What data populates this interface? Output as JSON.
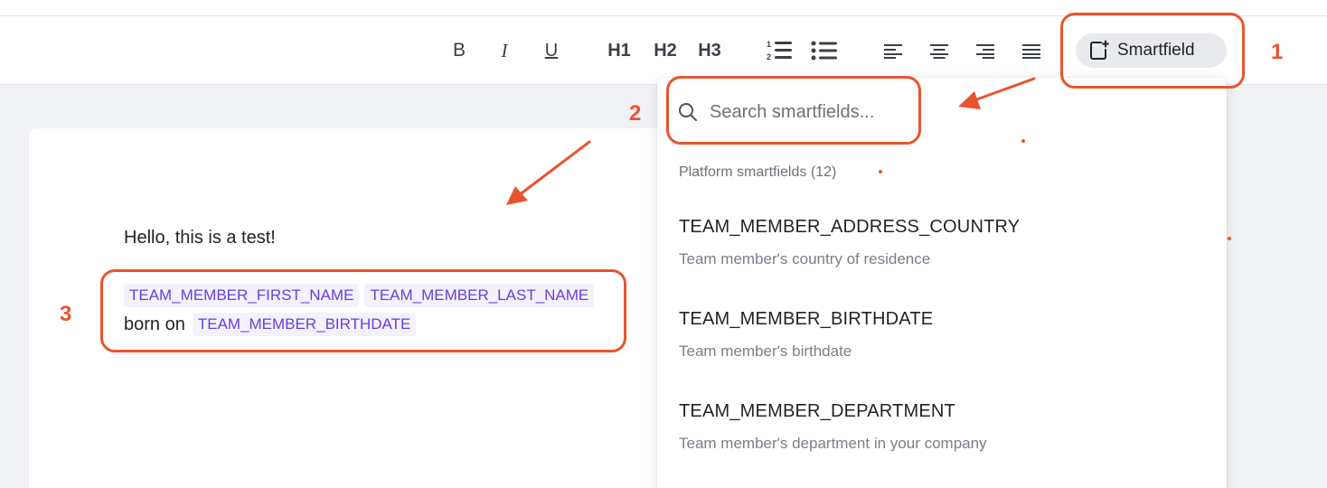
{
  "toolbar": {
    "bold": "B",
    "italic": "I",
    "underline": "U",
    "h1": "H1",
    "h2": "H2",
    "h3": "H3",
    "smartfield_label": "Smartfield"
  },
  "document": {
    "line1": "Hello, this is a test!",
    "chip_first_name": "TEAM_MEMBER_FIRST_NAME",
    "chip_last_name": "TEAM_MEMBER_LAST_NAME",
    "born_on": "born on",
    "chip_birthdate": "TEAM_MEMBER_BIRTHDATE"
  },
  "dropdown": {
    "search_placeholder": "Search smartfields...",
    "section_title": "Platform smartfields (12)",
    "items": [
      {
        "name": "TEAM_MEMBER_ADDRESS_COUNTRY",
        "desc": "Team member's country of residence"
      },
      {
        "name": "TEAM_MEMBER_BIRTHDATE",
        "desc": "Team member's birthdate"
      },
      {
        "name": "TEAM_MEMBER_DEPARTMENT",
        "desc": "Team member's department in your company"
      }
    ]
  },
  "annotations": {
    "n1": "1",
    "n2": "2",
    "n3": "3",
    "color": "#e8542f"
  },
  "colors": {
    "chip_text": "#6a3ddb",
    "chip_bg": "#f3f1fb",
    "page_bg": "#f1f2f5"
  }
}
